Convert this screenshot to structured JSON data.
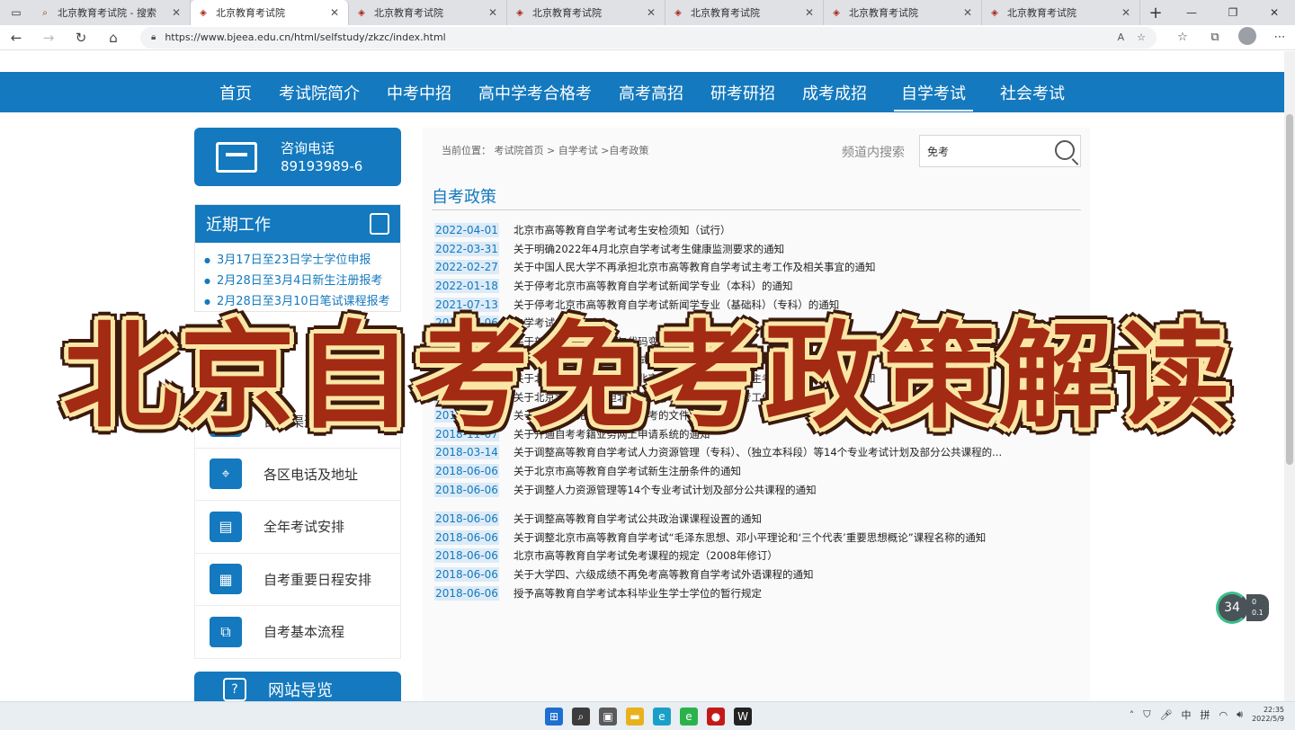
{
  "browser": {
    "tabs": [
      {
        "title": "北京教育考试院 - 搜索",
        "active": false,
        "icon": "search-icon"
      },
      {
        "title": "北京教育考试院",
        "active": true,
        "icon": "site-logo-icon"
      },
      {
        "title": "北京教育考试院",
        "active": false,
        "icon": "site-logo-icon"
      },
      {
        "title": "北京教育考试院",
        "active": false,
        "icon": "site-logo-icon"
      },
      {
        "title": "北京教育考试院",
        "active": false,
        "icon": "site-logo-icon"
      },
      {
        "title": "北京教育考试院",
        "active": false,
        "icon": "site-logo-icon"
      },
      {
        "title": "北京教育考试院",
        "active": false,
        "icon": "site-logo-icon"
      }
    ],
    "url": "https://www.bjeea.edu.cn/html/selfstudy/zkzc/index.html"
  },
  "nav": {
    "items": [
      "首页",
      "考试院简介",
      "中考中招",
      "高中学考合格考",
      "高考高招",
      "研考研招",
      "成考成招",
      "自学考试",
      "社会考试"
    ],
    "active_index": 7
  },
  "consult": {
    "label": "咨询电话",
    "phone": "89193989-6"
  },
  "recent": {
    "title": "近期工作",
    "items": [
      "3月17日至23日学士学位申报",
      "2月28日至3月4日新生注册报考",
      "2月28日至3月10日笔试课程报考"
    ]
  },
  "services": [
    {
      "label": "自考渠道",
      "icon": "person-icon"
    },
    {
      "label": "各区电话及地址",
      "icon": "map-pin-icon"
    },
    {
      "label": "全年考试安排",
      "icon": "document-icon"
    },
    {
      "label": "自考重要日程安排",
      "icon": "calendar-icon"
    },
    {
      "label": "自考基本流程",
      "icon": "flowchart-icon"
    }
  ],
  "sitenav": {
    "label": "网站导览"
  },
  "main": {
    "breadcrumb": "当前位置： 考试院首页 > 自学考试 >自考政策",
    "search_label": "频道内搜索",
    "search_value": "免考",
    "section_title": "自考政策",
    "news": [
      {
        "date": "2022-04-01",
        "title": "北京市高等教育自学考试考生安检须知（试行）"
      },
      {
        "date": "2022-03-31",
        "title": "关于明确2022年4月北京自学考试考生健康监测要求的通知"
      },
      {
        "date": "2022-02-27",
        "title": "关于中国人民大学不再承担北京市高等教育自学考试主考工作及相关事宜的通知"
      },
      {
        "date": "2022-01-18",
        "title": "关于停考北京市高等教育自学考试新闻学专业（本科）的通知"
      },
      {
        "date": "2021-07-13",
        "title": "关于停考北京市高等教育自学考试新闻学专业（基础科）（专科）的通知"
      },
      {
        "date": "2019-09-06",
        "title": "自学考试考试规则"
      },
      {
        "date": "2019-07-16",
        "title": "关于部分本科专业名称与代码变更情况的说明"
      },
      {
        "date": "2019-05-28",
        "title": "关于北京市高等教育自学考试采购管理专业（专升本）变更主考学校的通知"
      },
      {
        "date": "2019-05-28",
        "title": "关于北京师范大学不再承担北京市高等教育自学考试主考工作及有关事宜的通知"
      },
      {
        "date": "2018-12-10",
        "title": "关于北京大学不再承担北京市高等教育自学考试主考工作及有关事宜的通知"
      },
      {
        "date": "2018-11-12",
        "title": "关于北京自考免考、接考、转考的文件政策汇总"
      },
      {
        "date": "2018-11-07",
        "title": "关于开通自考考籍业务网上申请系统的通知"
      },
      {
        "date": "2018-03-14",
        "title": "关于调整高等教育自学考试人力资源管理（专科）、（独立本科段）等14个专业考试计划及部分公共课程的..."
      },
      {
        "date": "2018-06-06",
        "title": "关于北京市高等教育自学考试新生注册条件的通知"
      },
      {
        "date": "2018-06-06",
        "title": "关于调整人力资源管理等14个专业考试计划及部分公共课程的通知"
      },
      {
        "date": "2018-06-06",
        "title": "关于调整高等教育自学考试公共政治课课程设置的通知"
      },
      {
        "date": "2018-06-06",
        "title": "关于调整北京市高等教育自学考试“毛泽东思想、邓小平理论和‘三个代表’重要思想概论”课程名称的通知"
      },
      {
        "date": "2018-06-06",
        "title": "北京市高等教育自学考试免考课程的规定（2008年修订）"
      },
      {
        "date": "2018-06-06",
        "title": "关于大学四、六级成绩不再免考高等教育自学考试外语课程的通知"
      },
      {
        "date": "2018-06-06",
        "title": "授予高等教育自学考试本科毕业生学士学位的暂行规定"
      }
    ]
  },
  "overlay_title": "北京自考免考政策解读",
  "speed_widget": {
    "percent": "34",
    "up": "0",
    "down": "0.1"
  },
  "taskbar": {
    "ime": "中",
    "ime2": "拼",
    "time": "22:35",
    "date": "2022/5/9"
  },
  "colors": {
    "brand": "#1479be",
    "banner_text": "#a32a13",
    "banner_outline": "#fbe6a6"
  }
}
